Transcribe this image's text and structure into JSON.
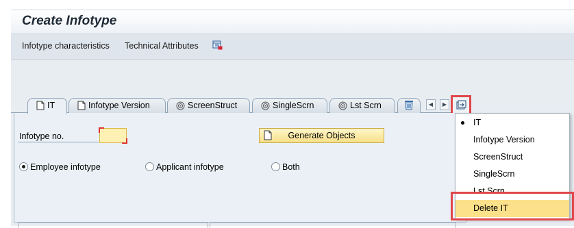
{
  "window": {
    "title": "Create Infotype"
  },
  "toolbar": {
    "items": [
      "Infotype characteristics",
      "Technical Attributes"
    ],
    "icon": "layout-icon"
  },
  "tabs": [
    {
      "label": "IT",
      "icon": "document-icon",
      "active": true
    },
    {
      "label": "Infotype Version",
      "icon": "document-icon",
      "active": false
    },
    {
      "label": "ScreenStruct",
      "icon": "spiral-icon",
      "active": false
    },
    {
      "label": "SingleScrn",
      "icon": "spiral-icon",
      "active": false
    },
    {
      "label": "Lst Scrn",
      "icon": "spiral-icon",
      "active": false
    }
  ],
  "form": {
    "infotype_label": "Infotype no.",
    "infotype_value": "",
    "generate_label": "Generate Objects",
    "radios": [
      {
        "label": "Employee infotype",
        "checked": true
      },
      {
        "label": "Applicant infotype",
        "checked": false
      },
      {
        "label": "Both",
        "checked": false
      }
    ]
  },
  "tab_menu": {
    "items": [
      {
        "label": "IT",
        "current": true
      },
      {
        "label": "Infotype Version",
        "current": false
      },
      {
        "label": "ScreenStruct",
        "current": false
      },
      {
        "label": "SingleScrn",
        "current": false
      },
      {
        "label": "Lst Scrn",
        "current": false
      },
      {
        "label": "Delete IT",
        "current": false,
        "selected": true
      }
    ]
  },
  "colors": {
    "highlight": "#e0464a",
    "menu_selected": "#fde18a",
    "input_bg": "#fff0b3"
  }
}
